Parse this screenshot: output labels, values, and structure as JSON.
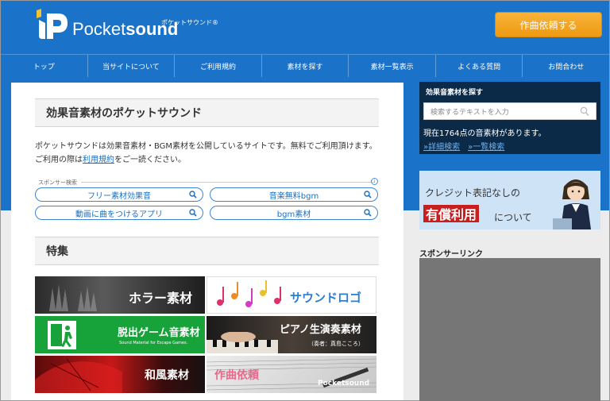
{
  "header": {
    "logo_text_light": "Pocket",
    "logo_text_bold": "sound",
    "logo_sub": "ポケットサウンド",
    "logo_reg": "®",
    "cta_label": "作曲依頼する",
    "brand_color": "#1a73c9",
    "cta_color": "#f4a623"
  },
  "nav": {
    "items": [
      "トップ",
      "当サイトについて",
      "ご利用規約",
      "素材を探す",
      "素材一覧表示",
      "よくある質問",
      "お問合わせ"
    ]
  },
  "main": {
    "title": "効果音素材のポケットサウンド",
    "intro_part1": "ポケットサウンドは効果音素材・BGM素材を公開しているサイトです。無料でご利用頂けます。ご利用の際は",
    "intro_link": "利用規約",
    "intro_part2": "をご一読ください。",
    "sponsor_label": "スポンサー検索",
    "info_icon": "i",
    "search_pills": [
      "フリー素材効果音",
      "音楽無料bgm",
      "動画に曲をつけるアプリ",
      "bgm素材"
    ],
    "feature_title": "特集",
    "tiles": [
      {
        "label": "ホラー素材"
      },
      {
        "label": "サウンドロゴ"
      },
      {
        "label": "脱出ゲーム音素材",
        "sub": "Sound Material for Escape Games."
      },
      {
        "label": "ピアノ生演奏素材",
        "sub": "（奏者：真島こころ）"
      },
      {
        "label": "和風素材"
      },
      {
        "label": "作曲依頼",
        "sub": "Pocketsound"
      }
    ]
  },
  "sidebar": {
    "search_title": "効果音素材を探す",
    "search_placeholder": "検索するテキストを入力",
    "count_text": "現在1764点の音素材があります。",
    "link_detail": "»詳細検索",
    "link_list": "»一覧検索",
    "banner_line1": "クレジット表記なしの",
    "banner_red": "有償利用",
    "banner_line2": "について",
    "sponsor_link_title": "スポンサーリンク"
  }
}
